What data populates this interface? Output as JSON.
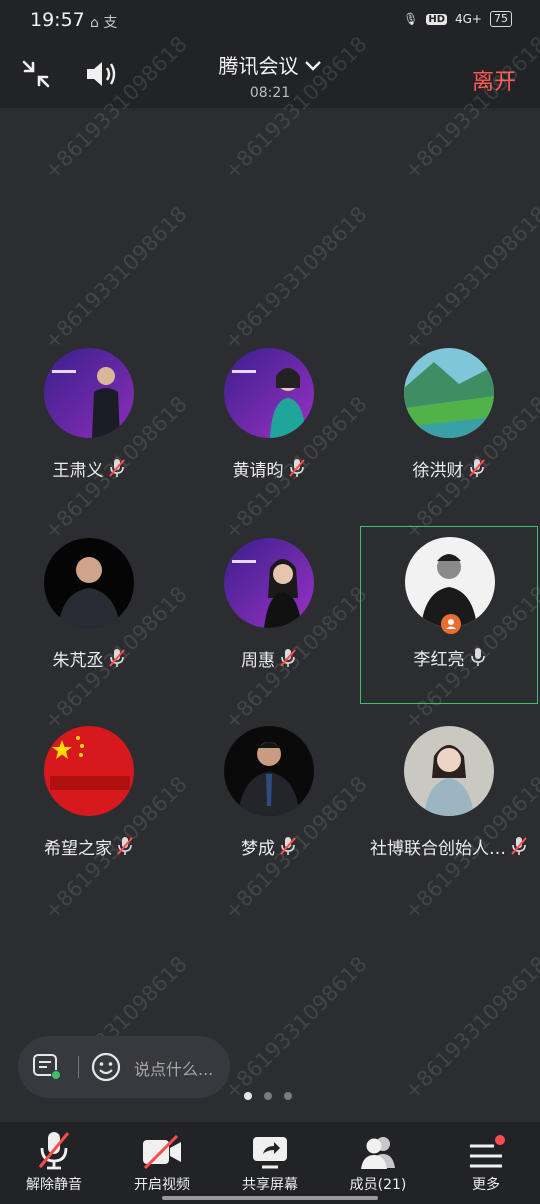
{
  "status_bar": {
    "time": "19:57",
    "left_icons": "⌂ 支",
    "network": "4G+",
    "hd": "HD",
    "battery": "75"
  },
  "header": {
    "title": "腾讯会议",
    "timer": "08:21",
    "leave": "离开"
  },
  "participants": [
    {
      "name": "王肃义",
      "mic": "muted",
      "avatar": "portrait-purple"
    },
    {
      "name": "黄请昀",
      "mic": "muted",
      "avatar": "portrait-purple"
    },
    {
      "name": "徐洪财",
      "mic": "muted",
      "avatar": "landscape"
    },
    {
      "name": "朱芃丞",
      "mic": "muted",
      "avatar": "portrait-dark"
    },
    {
      "name": "周惠",
      "mic": "muted",
      "avatar": "portrait-purple"
    },
    {
      "name": "李红亮",
      "mic": "on",
      "avatar": "portrait-bw",
      "host": true,
      "active": true
    },
    {
      "name": "希望之家",
      "mic": "muted",
      "avatar": "flag"
    },
    {
      "name": "梦成",
      "mic": "muted",
      "avatar": "portrait-dark"
    },
    {
      "name": "社博联合创始人…",
      "mic": "muted",
      "avatar": "portrait-light"
    }
  ],
  "chat": {
    "placeholder": "说点什么..."
  },
  "pager": {
    "pages": 3,
    "current": 0
  },
  "toolbar": {
    "unmute": "解除静音",
    "video": "开启视频",
    "share": "共享屏幕",
    "members": "成员(21)",
    "more": "更多"
  },
  "colors": {
    "leave": "#ff5a52",
    "active_border": "#3fbf6a",
    "mute_slash": "#ff4d4d"
  }
}
